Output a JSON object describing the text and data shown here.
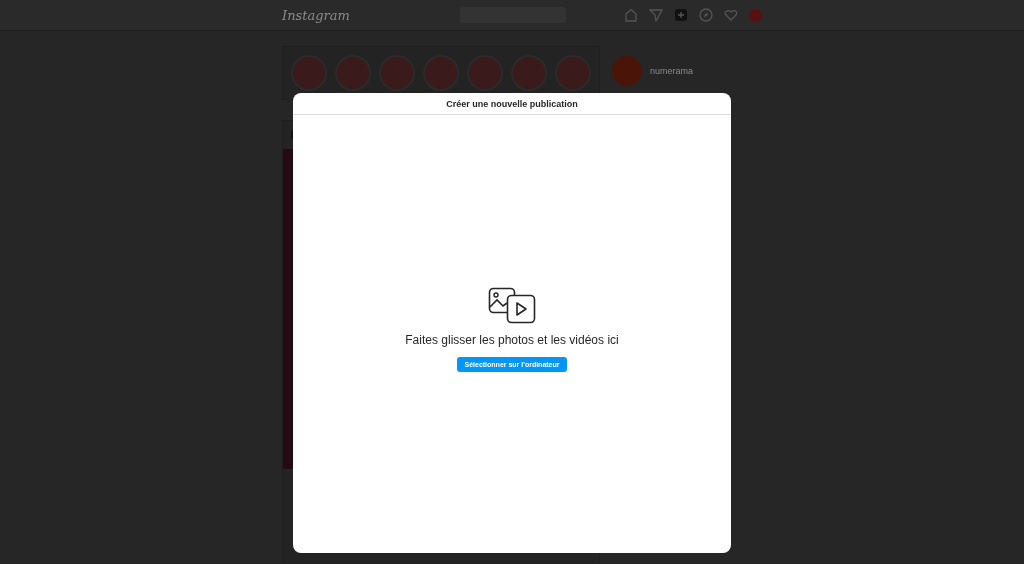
{
  "header": {
    "logo": "Instagram"
  },
  "suggestion": {
    "username": "numerama"
  },
  "modal": {
    "title": "Créer une nouvelle publication",
    "message": "Faites glisser les photos et les vidéos ici",
    "button": "Sélectionner sur l'ordinateur"
  }
}
